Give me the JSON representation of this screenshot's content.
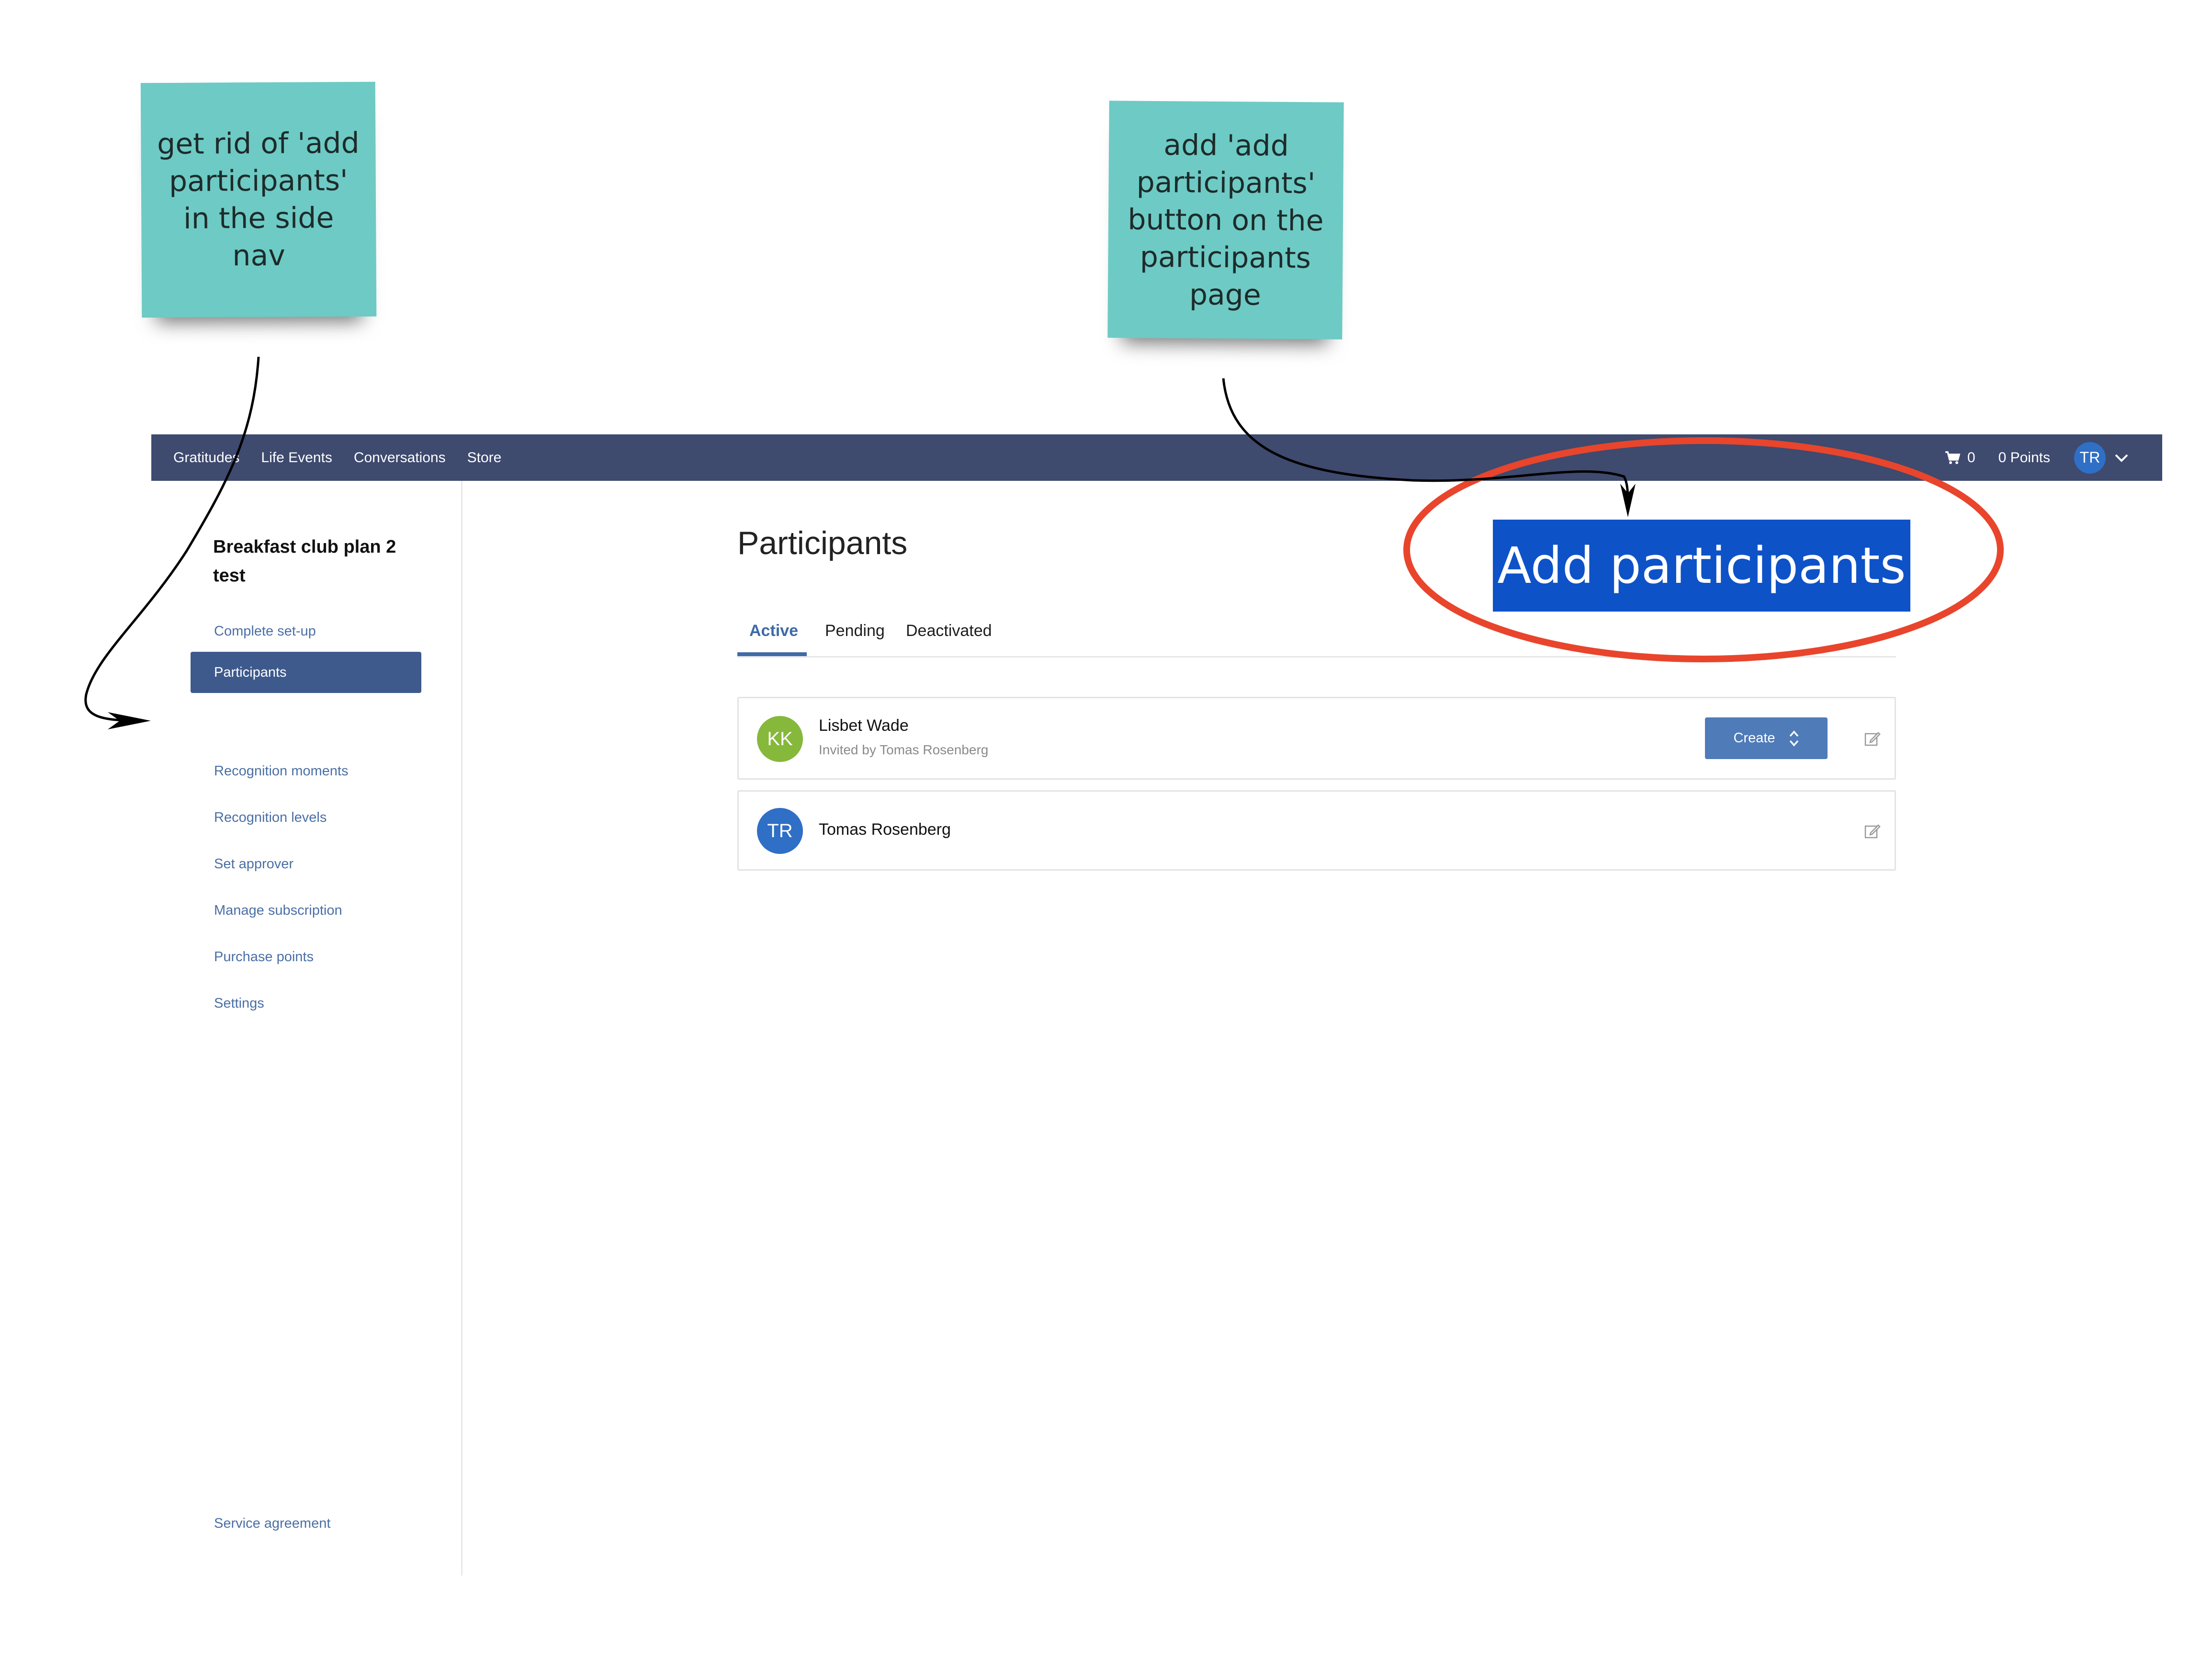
{
  "annotations": {
    "note_left": "get rid of 'add participants' in the side nav",
    "note_right": "add 'add participants' button on the participants page",
    "add_button_label": "Add participants"
  },
  "topnav": {
    "links": [
      "Gratitudes",
      "Life Events",
      "Conversations",
      "Store"
    ],
    "cart_count": "0",
    "points": "0 Points",
    "user_initials": "TR"
  },
  "sidebar": {
    "project_title": "Breakfast club plan 2 test",
    "items": [
      {
        "label": "Complete set-up"
      },
      {
        "label": "Participants"
      },
      {
        "label": "Recognition moments"
      },
      {
        "label": "Recognition levels"
      },
      {
        "label": "Set approver"
      },
      {
        "label": "Manage subscription"
      },
      {
        "label": "Purchase points"
      },
      {
        "label": "Settings"
      }
    ],
    "footer_link": "Service agreement"
  },
  "main": {
    "title": "Participants",
    "tabs": [
      {
        "label": "Active"
      },
      {
        "label": "Pending"
      },
      {
        "label": "Deactivated"
      }
    ],
    "participants": [
      {
        "initials": "KK",
        "name": "Lisbet Wade",
        "subtitle": "Invited by Tomas Rosenberg",
        "action_label": "Create",
        "avatar_color": "#86b83c"
      },
      {
        "initials": "TR",
        "name": "Tomas Rosenberg",
        "avatar_color": "#2f6fc6"
      }
    ]
  },
  "colors": {
    "nav_bg": "#3e4a6e",
    "accent": "#3e6aa8",
    "sticky": "#6ecac4",
    "annotation_button": "#0e52c8",
    "annotation_ring": "#e8452c"
  }
}
